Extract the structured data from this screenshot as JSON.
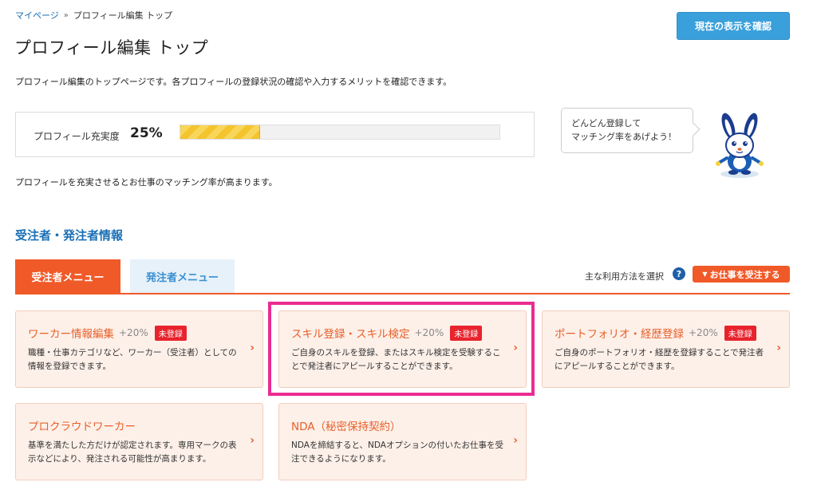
{
  "breadcrumb": {
    "home": "マイページ",
    "separator": "»",
    "current": "プロフィール編集 トップ"
  },
  "confirm_button": "現在の表示を確認",
  "page_title": "プロフィール編集 トップ",
  "page_description": "プロフィール編集のトップページです。各プロフィールの登録状況の確認や入力するメリットを確認できます。",
  "completion": {
    "label": "プロフィール充実度",
    "value": "25%",
    "progress_fraction": 0.25
  },
  "speech_bubble": {
    "line1": "どんどん登録して",
    "line2": "マッチング率をあげよう！"
  },
  "matching_note": "プロフィールを充実させるとお仕事のマッチング率が高まります。",
  "section_title": "受注者・発注者情報",
  "tabs": {
    "worker": "受注者メニュー",
    "client": "発注者メニュー"
  },
  "usage": {
    "label": "主な利用方法を選択",
    "help": "?",
    "button": "お仕事を受注する"
  },
  "cards": [
    {
      "title": "ワーカー情報編集",
      "pct": "+20%",
      "badge": "未登録",
      "desc": "職種・仕事カテゴリなど、ワーカー（受注者）としての情報を登録できます。"
    },
    {
      "title": "スキル登録・スキル検定",
      "pct": "+20%",
      "badge": "未登録",
      "desc": "ご自身のスキルを登録、またはスキル検定を受験することで発注者にアピールすることができます。"
    },
    {
      "title": "ポートフォリオ・経歴登録",
      "pct": "+20%",
      "badge": "未登録",
      "desc": "ご自身のポートフォリオ・経歴を登録することで発注者にアピールすることができます。"
    },
    {
      "title": "プロクラウドワーカー",
      "desc": "基準を満たした方だけが認定されます。専用マークの表示などにより、発注される可能性が高まります。"
    },
    {
      "title": "NDA（秘密保持契約）",
      "desc": "NDAを締結すると、NDAオプションの付いたお仕事を受注できるようになります。"
    }
  ],
  "icons": {
    "chevron": "chevron-right-icon",
    "caret": "caret-down-icon",
    "mascot": "mascot-icon"
  },
  "colors": {
    "accent": "#f05a28",
    "link": "#1a6fb5",
    "badge": "#e8232d",
    "highlight": "#ea2c92",
    "confirm": "#3aa0dc"
  }
}
